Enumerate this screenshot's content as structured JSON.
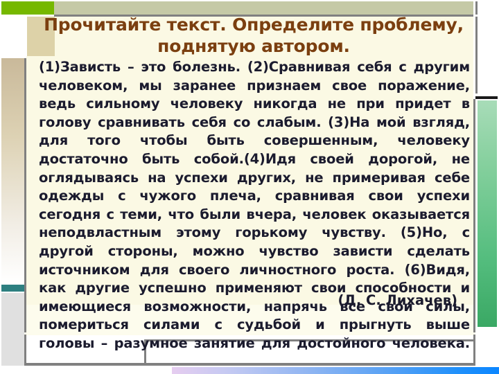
{
  "slide": {
    "title": "Прочитайте текст. Определите проблему, поднятую автором.",
    "body": "(1)Зависть – это болезнь. (2)Сравнивая себя с другим человеком, мы заранее признаем свое поражение, ведь сильному человеку никогда не при   придет    в голову сравнивать себя со слабым. (3)На мой взгляд, для того чтобы быть совершенным, человеку достаточно быть собой.(4)Идя своей дорогой, не оглядываясь на успехи других, не примеривая себе одежды с чужого плеча, сравнивая свои успехи сегодня с теми, что были вчера, человек оказывается неподвластным этому горькому чувству. (5)Но, с другой стороны, можно чувство зависти сделать источником для своего личностного роста. (6)Видя, как другие успешно применяют свои способности и имеющиеся возможности, напрячь все свои силы, помериться силами с судьбой и прыгнуть выше головы – разумное занятие для достойного человека.",
    "attribution": "(Д. С. Лихачев)"
  },
  "colors": {
    "title_text": "#7b3f10",
    "body_text": "#1b1b2e",
    "card_background": "#fbf9e4",
    "green_tab": "#76b800",
    "olive_strip": "#c5c9a6",
    "tan_box": "#ddd2a8",
    "teal_bar": "#2d7f80",
    "frame_border": "#808080",
    "green_column_top": "#a8dcb8",
    "green_column_bottom": "#3aa864",
    "blue_bar_start": "#e6cdf0",
    "blue_bar_end": "#0b86ff"
  }
}
